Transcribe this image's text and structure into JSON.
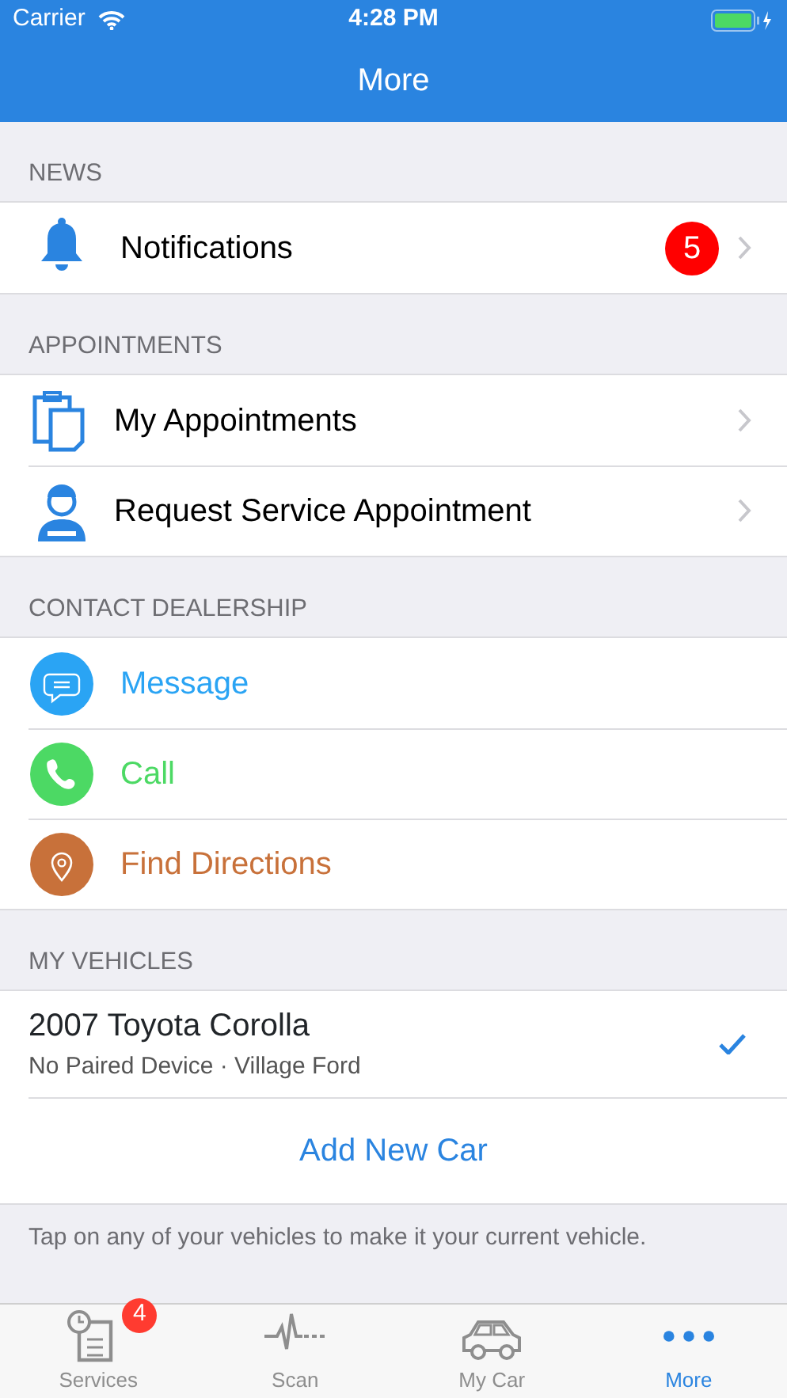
{
  "status_bar": {
    "carrier": "Carrier",
    "time": "4:28 PM"
  },
  "nav_bar": {
    "title": "More"
  },
  "sections": [
    {
      "header": "NEWS",
      "rows": [
        {
          "kind": "nav",
          "label": "Notifications",
          "badge": "5"
        }
      ]
    },
    {
      "header": "APPOINTMENTS",
      "rows": [
        {
          "kind": "nav",
          "label": "My Appointments"
        },
        {
          "kind": "nav",
          "label": "Request Service Appointment"
        }
      ]
    },
    {
      "header": "CONTACT DEALERSHIP",
      "rows": [
        {
          "kind": "action",
          "label": "Message",
          "color": "#2aa4f4"
        },
        {
          "kind": "action",
          "label": "Call",
          "color": "#4cd964"
        },
        {
          "kind": "action",
          "label": "Find Directions",
          "color": "#c8713a"
        }
      ]
    },
    {
      "header": "MY VEHICLES",
      "rows": [
        {
          "kind": "vehicle",
          "label": "2007 Toyota Corolla",
          "subtitle": "No Paired Device · Village Ford",
          "selected": true
        },
        {
          "kind": "add",
          "label": "Add New Car"
        }
      ]
    }
  ],
  "footer_note": "Tap on any of your vehicles to make it your current vehicle.",
  "tab_bar": [
    {
      "label": "Services",
      "badge": "4",
      "selected": false
    },
    {
      "label": "Scan",
      "selected": false
    },
    {
      "label": "My Car",
      "selected": false
    },
    {
      "label": "More",
      "selected": true
    }
  ]
}
